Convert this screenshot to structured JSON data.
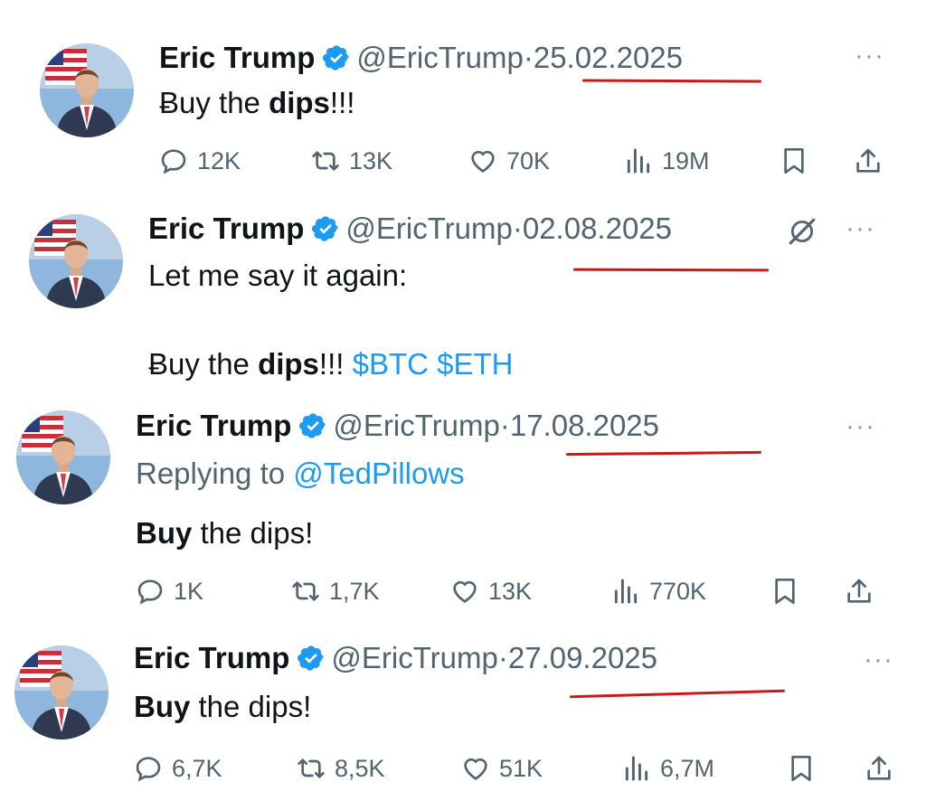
{
  "tweets": [
    {
      "name": "Eric Trump",
      "handle": "@EricTrump",
      "separator": "·",
      "date": "25.02.2025",
      "more": "···",
      "text_parts": [
        "Ƀuy the ",
        "dips",
        "!!!"
      ],
      "stats": {
        "replies": "12K",
        "reposts": "13K",
        "likes": "70K",
        "views": "19M"
      }
    },
    {
      "name": "Eric Trump",
      "handle": "@EricTrump",
      "separator": "·",
      "date": "02.08.2025",
      "more": "···",
      "text_line1": "Let me say it again:",
      "text_parts": [
        "Ƀuy the ",
        "dips",
        "!!! ",
        "$BTC",
        " ",
        "$ETH"
      ]
    },
    {
      "name": "Eric Trump",
      "handle": "@EricTrump",
      "separator": "·",
      "date": "17.08.2025",
      "more": "···",
      "replying_prefix": "Replying to ",
      "replying_to": "@TedPillows",
      "text_parts": [
        "Buy",
        " the dips!"
      ],
      "stats": {
        "replies": "1K",
        "reposts": "1,7K",
        "likes": "13K",
        "views": "770K"
      }
    },
    {
      "name": "Eric Trump",
      "handle": "@EricTrump",
      "separator": "·",
      "date": "27.09.2025",
      "more": "···",
      "text_parts": [
        "Buy",
        " the dips!"
      ],
      "stats": {
        "replies": "6,7K",
        "reposts": "8,5K",
        "likes": "51K",
        "views": "6,7M"
      }
    }
  ],
  "icons": {
    "reply": "speech-bubble-icon",
    "repost": "repost-arrows-icon",
    "like": "heart-icon",
    "views": "bar-chart-icon",
    "bookmark": "bookmark-icon",
    "share": "share-upload-icon",
    "grok": "grok-slash-icon",
    "verified": "verified-badge-icon"
  },
  "colors": {
    "link": "#1d9bf0",
    "verified": "#1d9bf0",
    "underline": "#c91a1a",
    "muted": "#536471"
  }
}
